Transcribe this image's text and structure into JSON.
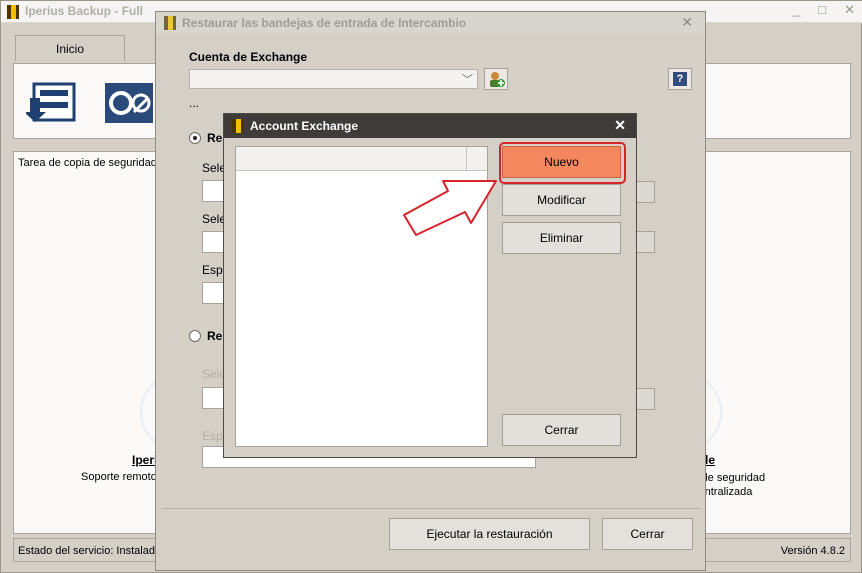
{
  "main_window": {
    "title": "Iperius Backup - Full",
    "controls": [
      "_",
      "□",
      "✕"
    ],
    "tab_label": "Inicio",
    "task_header": "Tarea de copia de seguridad",
    "feature_left_title": "Iperi",
    "feature_left_desc": "Soporte remoto",
    "feature_right_title": "le",
    "feature_right_desc_line1": "s de seguridad",
    "feature_right_desc_line2": "centralizada",
    "status_text": "Estado del servicio: Instalado",
    "version": "Versión 4.8.2",
    "icons": [
      "backup-restore-icon",
      "remote-support-icon"
    ]
  },
  "restore_dialog": {
    "title": "Restaurar las bandejas de entrada de Intercambio",
    "account_label": "Cuenta de Exchange",
    "account_value": "",
    "ellipsis": "...",
    "radio1_label": "Res",
    "radio1_selected": true,
    "select_label_1": "Selec",
    "select_label_2": "Selec",
    "specify_label_1": "Espe",
    "radio2_label": "Res",
    "radio2_selected": false,
    "select_label_3": "Selec",
    "specify_label_2": "Espe",
    "run_button": "Ejecutar la restauración",
    "close_button": "Cerrar",
    "help_label": "?"
  },
  "account_dialog": {
    "title": "Account Exchange",
    "close_glyph": "✕",
    "new_button": "Nuevo",
    "edit_button": "Modificar",
    "delete_button": "Eliminar",
    "close_button": "Cerrar",
    "highlight_color": "#d9232b",
    "primary_color": "#f5875f"
  }
}
